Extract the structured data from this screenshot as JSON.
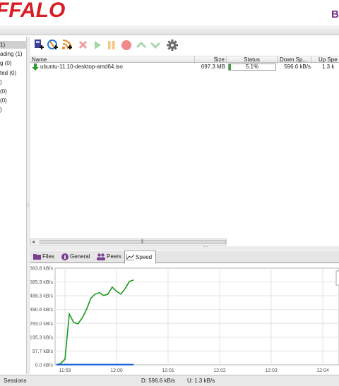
{
  "header": {
    "logo_text": "FFALO",
    "right_text": "Bi"
  },
  "sidebar": {
    "items": [
      {
        "label": "1)",
        "active": true
      },
      {
        "label": "ading (1)"
      },
      {
        "label": "g (0)"
      },
      {
        "label": "ted (0)"
      },
      {
        "label": ")"
      },
      {
        "label": " (0)"
      },
      {
        "label": " (0)"
      },
      {
        "label": ")"
      }
    ]
  },
  "toolbar": {
    "buttons": [
      {
        "name": "add-torrent-button",
        "icon": "add-file-icon",
        "enabled": true
      },
      {
        "name": "add-url-button",
        "icon": "add-url-icon",
        "enabled": true
      },
      {
        "name": "add-rss-button",
        "icon": "add-rss-icon",
        "enabled": true
      },
      {
        "name": "remove-button",
        "icon": "remove-icon",
        "enabled": false
      },
      {
        "name": "start-button",
        "icon": "play-icon",
        "enabled": false
      },
      {
        "name": "pause-button",
        "icon": "pause-icon",
        "enabled": false
      },
      {
        "name": "stop-button",
        "icon": "stop-icon",
        "enabled": false
      },
      {
        "name": "move-up-button",
        "icon": "chevron-up-icon",
        "enabled": false
      },
      {
        "name": "move-down-button",
        "icon": "chevron-down-icon",
        "enabled": false
      },
      {
        "name": "settings-button",
        "icon": "gear-icon",
        "enabled": true
      }
    ]
  },
  "table": {
    "columns": {
      "name": "Name",
      "size": "Size",
      "status": "Status",
      "down": "Down Sp...",
      "up": "Up Spe"
    },
    "rows": [
      {
        "name": "ubuntu-11.10-desktop-amd64.iso",
        "size": "697.3 MB",
        "status": "5.1%",
        "progress": 0.051,
        "down": "596.6 kB/s",
        "up": "1.3 k"
      }
    ]
  },
  "tabs": [
    {
      "label": "Files",
      "icon": "folder-icon"
    },
    {
      "label": "General",
      "icon": "info-icon"
    },
    {
      "label": "Peers",
      "icon": "peers-icon"
    },
    {
      "label": "Speed",
      "icon": "speed-chart-icon",
      "active": true
    }
  ],
  "chart_data": {
    "type": "line",
    "y_ticks": [
      "683.8 kB/s",
      "585.9 kB/s",
      "488.3 kB/s",
      "390.6 kB/s",
      "293.0 kB/s",
      "195.3 kB/s",
      "97.7 kB/s",
      "0.0 kB/s"
    ],
    "x_ticks": [
      "11:59",
      "12:00",
      "12:01",
      "12:02",
      "12:03",
      "12:04"
    ],
    "ylim": [
      0,
      683.8
    ],
    "colors": {
      "download": "#1a9a1a",
      "upload": "#1f63d8"
    },
    "series": [
      {
        "name": "",
        "color": "#1a9a1a",
        "x": [
          "11:58:50",
          "11:58:55",
          "11:59:00",
          "11:59:05",
          "11:59:10",
          "11:59:15",
          "11:59:20",
          "11:59:25",
          "11:59:30",
          "11:59:35",
          "11:59:40",
          "11:59:45",
          "11:59:50",
          "11:59:55",
          "12:00:00",
          "12:00:05",
          "12:00:10",
          "12:00:15",
          "12:00:20"
        ],
        "values": [
          0,
          10,
          40,
          360,
          300,
          290,
          330,
          390,
          470,
          500,
          510,
          490,
          500,
          550,
          520,
          500,
          540,
          590,
          600
        ]
      },
      {
        "name": "",
        "color": "#1f63d8",
        "x": [
          "11:58:50",
          "12:00:20"
        ],
        "values": [
          1.3,
          1.3
        ]
      }
    ]
  },
  "status": {
    "sessions_label": "Sessions",
    "down": "D: 596.6 kB/s",
    "up": "U: 1.3 kB/s"
  }
}
